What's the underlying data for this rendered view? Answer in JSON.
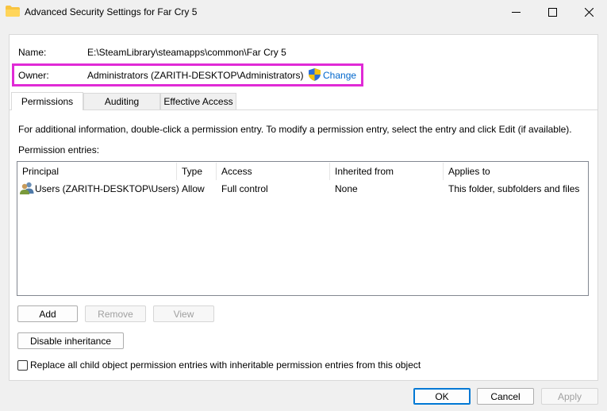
{
  "window": {
    "title": "Advanced Security Settings for Far Cry 5"
  },
  "icons": {
    "folder": "folder-icon",
    "minimize": "minimize-icon",
    "maximize": "maximize-icon",
    "close": "close-icon",
    "shield": "uac-shield-icon",
    "users": "users-icon"
  },
  "info": {
    "name_label": "Name:",
    "name_value": "E:\\SteamLibrary\\steamapps\\common\\Far Cry 5",
    "owner_label": "Owner:",
    "owner_value": "Administrators (ZARITH-DESKTOP\\Administrators)",
    "change_link": "Change"
  },
  "tabs": [
    {
      "label": "Permissions",
      "active": true
    },
    {
      "label": "Auditing",
      "active": false
    },
    {
      "label": "Effective Access",
      "active": false
    }
  ],
  "permissions": {
    "instructions": "For additional information, double-click a permission entry. To modify a permission entry, select the entry and click Edit (if available).",
    "entries_label": "Permission entries:",
    "columns": [
      "Principal",
      "Type",
      "Access",
      "Inherited from",
      "Applies to"
    ],
    "rows": [
      {
        "principal": "Users (ZARITH-DESKTOP\\Users)",
        "type": "Allow",
        "access": "Full control",
        "inherited_from": "None",
        "applies_to": "This folder, subfolders and files"
      }
    ],
    "add_button": "Add",
    "remove_button": "Remove",
    "view_button": "View",
    "disable_inheritance_button": "Disable inheritance",
    "replace_checkbox_label": "Replace all child object permission entries with inheritable permission entries from this object",
    "replace_checked": false
  },
  "footer": {
    "ok": "OK",
    "cancel": "Cancel",
    "apply": "Apply"
  },
  "colors": {
    "highlight_border": "#e02ad6",
    "link": "#0066cc",
    "primary_button_border": "#0078d4"
  }
}
